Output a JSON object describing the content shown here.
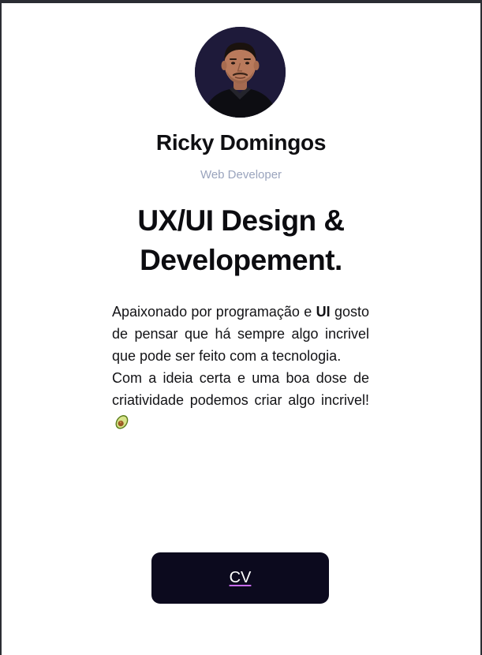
{
  "profile": {
    "avatar_icon": "person-portrait",
    "name": "Ricky Domingos",
    "role": "Web Developer"
  },
  "headline": {
    "line1": "UX/UI Design &",
    "line2": "Developement."
  },
  "bio": {
    "p1_prefix": "Apaixonado por programação e ",
    "p1_bold": "UI",
    "p1_rest": " gosto de pensar que há sempre algo incrivel que pode ser feito com a tecnologia.",
    "p2_text": "Com a ideia certa e uma boa dose de criatividade podemos criar algo incrivel!",
    "emoji_icon": "avocado-icon"
  },
  "cv_button": {
    "label": "CV"
  },
  "colors": {
    "avatar_bg": "#1e1a3a",
    "role_text": "#9aa4bd",
    "button_bg": "#0c0a1e",
    "link_underline": "#c86bf0"
  }
}
